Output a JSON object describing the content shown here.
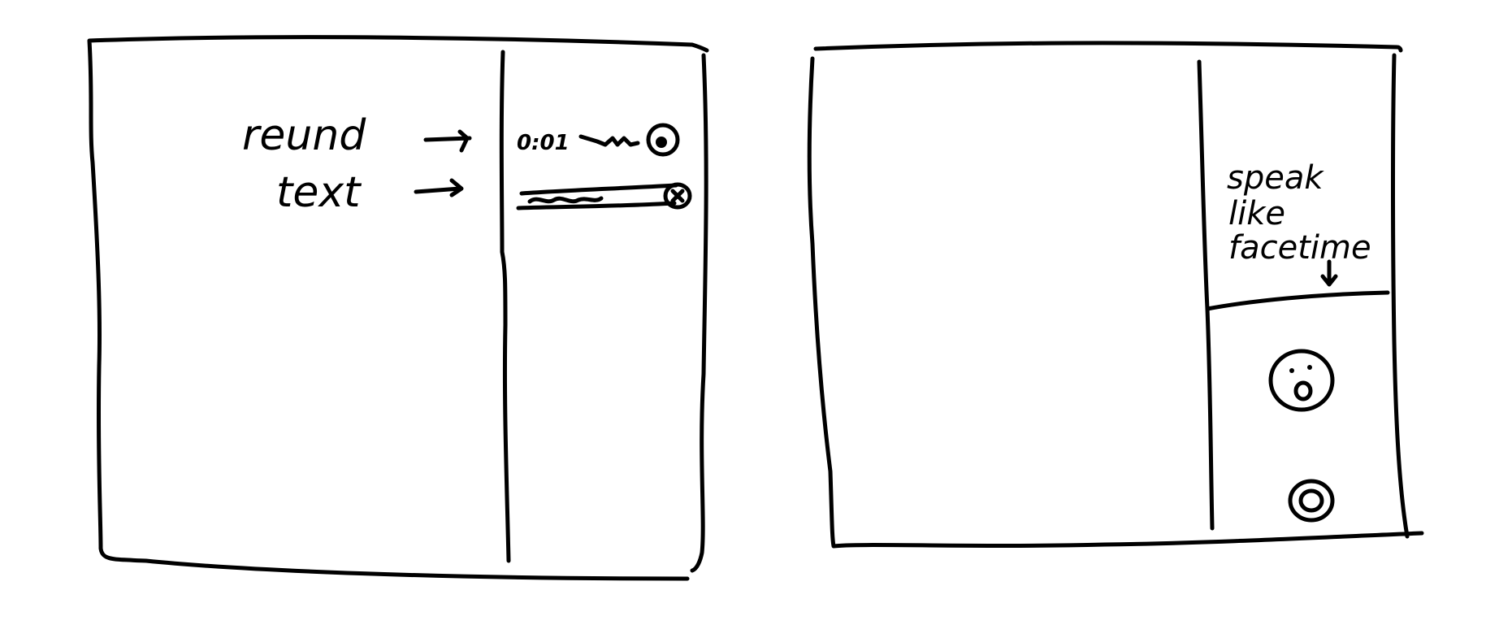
{
  "left_sketch": {
    "labels": {
      "record": "reund",
      "text": "text"
    },
    "record_row": {
      "timer": "0:01"
    },
    "icons": {
      "record_button": "record-stop-icon",
      "text_close": "close-icon",
      "waveform": "waveform-icon",
      "arrows": "arrow-right-icon"
    }
  },
  "right_sketch": {
    "note": {
      "line1": "speak",
      "line2": "like",
      "line3": "facetime"
    },
    "icons": {
      "arrow": "arrow-down-icon",
      "face": "face-icon",
      "call_button": "call-button-icon"
    }
  },
  "colors": {
    "ink": "#000000",
    "paper": "#ffffff"
  }
}
